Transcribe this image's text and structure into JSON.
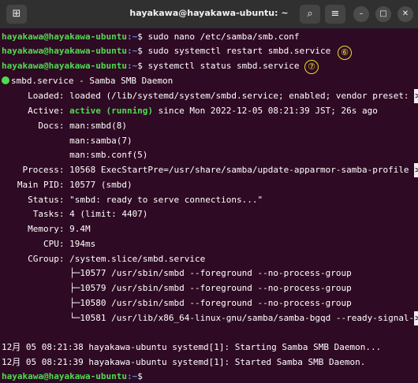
{
  "window": {
    "title": "hayakawa@hayakawa-ubuntu: ~",
    "new_tab_icon": "new-tab-icon",
    "search_icon": "search-icon",
    "menu_icon": "hamburger-menu-icon"
  },
  "prompt": {
    "user": "hayakawa@hayakawa-ubuntu",
    "path": ":~",
    "symbol": "$"
  },
  "commands": [
    " sudo nano /etc/samba/smb.conf",
    " sudo systemctl restart smbd.service",
    " systemctl status smbd.service"
  ],
  "markers": [
    "⑥",
    "⑦"
  ],
  "status": {
    "header": "smbd.service - Samba SMB Daemon",
    "loaded": "     Loaded: loaded (/lib/systemd/system/smbd.service; enabled; vendor preset: ",
    "active_label": "     Active: ",
    "active_value": "active (running)",
    "active_rest": " since Mon 2022-12-05 08:21:39 JST; 26s ago",
    "docs": "       Docs: man:smbd(8)",
    "docs2": "             man:samba(7)",
    "docs3": "             man:smb.conf(5)",
    "process": "    Process: 10568 ExecStartPre=/usr/share/samba/update-apparmor-samba-profile ",
    "mainpid": "   Main PID: 10577 (smbd)",
    "statusline": "     Status: \"smbd: ready to serve connections...\"",
    "tasks": "      Tasks: 4 (limit: 4407)",
    "memory": "     Memory: 9.4M",
    "cpu": "        CPU: 194ms",
    "cgroup": "     CGroup: /system.slice/smbd.service",
    "tree": [
      "             ├─10577 /usr/sbin/smbd --foreground --no-process-group",
      "             ├─10579 /usr/sbin/smbd --foreground --no-process-group",
      "             ├─10580 /usr/sbin/smbd --foreground --no-process-group",
      "             └─10581 /usr/lib/x86_64-linux-gnu/samba/samba-bgqd --ready-signal-"
    ],
    "trunc_mark": ">"
  },
  "logs": [
    "12月 05 08:21:38 hayakawa-ubuntu systemd[1]: Starting Samba SMB Daemon...",
    "12月 05 08:21:39 hayakawa-ubuntu systemd[1]: Started Samba SMB Daemon."
  ]
}
